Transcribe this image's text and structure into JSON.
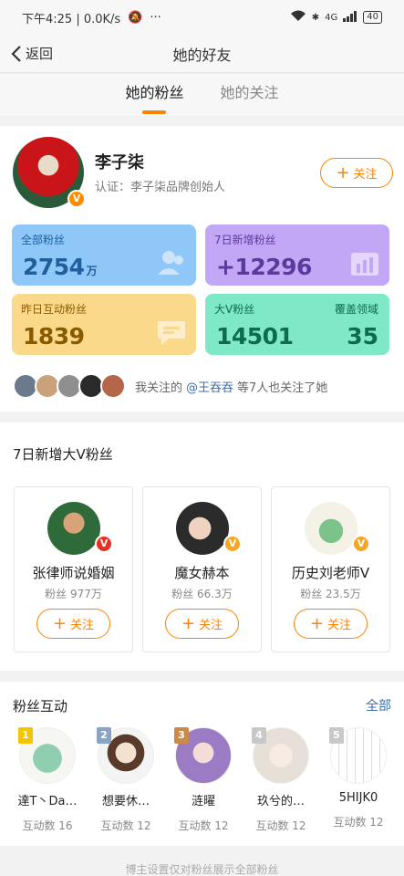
{
  "status": {
    "time_net": "下午4:25 | 0.0K/s",
    "dots": "···",
    "battery": "40",
    "net_label": "4G"
  },
  "nav": {
    "back_label": "返回",
    "title": "她的好友"
  },
  "tabs": [
    {
      "label": "她的粉丝",
      "active": true
    },
    {
      "label": "她的关注",
      "active": false
    }
  ],
  "profile": {
    "name": "李子柒",
    "cert": "认证：李子柒品牌创始人",
    "follow_label": "关注",
    "stats": {
      "all_fans_label": "全部粉丝",
      "all_fans_value": "2754",
      "all_fans_unit": "万",
      "new7_label": "7日新增粉丝",
      "new7_value": "+12296",
      "interact_label": "昨日互动粉丝",
      "interact_value": "1839",
      "bigv_label": "大V粉丝",
      "bigv_value": "14501",
      "domain_label": "覆盖领域",
      "domain_value": "35"
    },
    "mutual": {
      "prefix": "我关注的",
      "link": "@王吞吞",
      "suffix": "等7人也关注了她"
    }
  },
  "new_bigv": {
    "title": "7日新增大V粉丝",
    "items": [
      {
        "name": "张律师说婚姻",
        "fans": "粉丝 977万",
        "follow_label": "关注"
      },
      {
        "name": "魔女赫本",
        "fans": "粉丝 66.3万",
        "follow_label": "关注"
      },
      {
        "name": "历史刘老师V",
        "fans": "粉丝 23.5万",
        "follow_label": "关注"
      }
    ]
  },
  "fan_interaction": {
    "title": "粉丝互动",
    "see_all": "全部",
    "items": [
      {
        "rank": "1",
        "name": "達T丶Da…",
        "count": "互动数 16"
      },
      {
        "rank": "2",
        "name": "想要休…",
        "count": "互动数 12"
      },
      {
        "rank": "3",
        "name": "涟曜",
        "count": "互动数 12"
      },
      {
        "rank": "4",
        "name": "玖兮的…",
        "count": "互动数 12"
      },
      {
        "rank": "5",
        "name": "5HIJK0",
        "count": "互动数 12"
      }
    ]
  },
  "footer": "博主设置仅对粉丝展示全部粉丝",
  "colors": {
    "accent": "#ff8200",
    "link": "#3b6ea8"
  }
}
